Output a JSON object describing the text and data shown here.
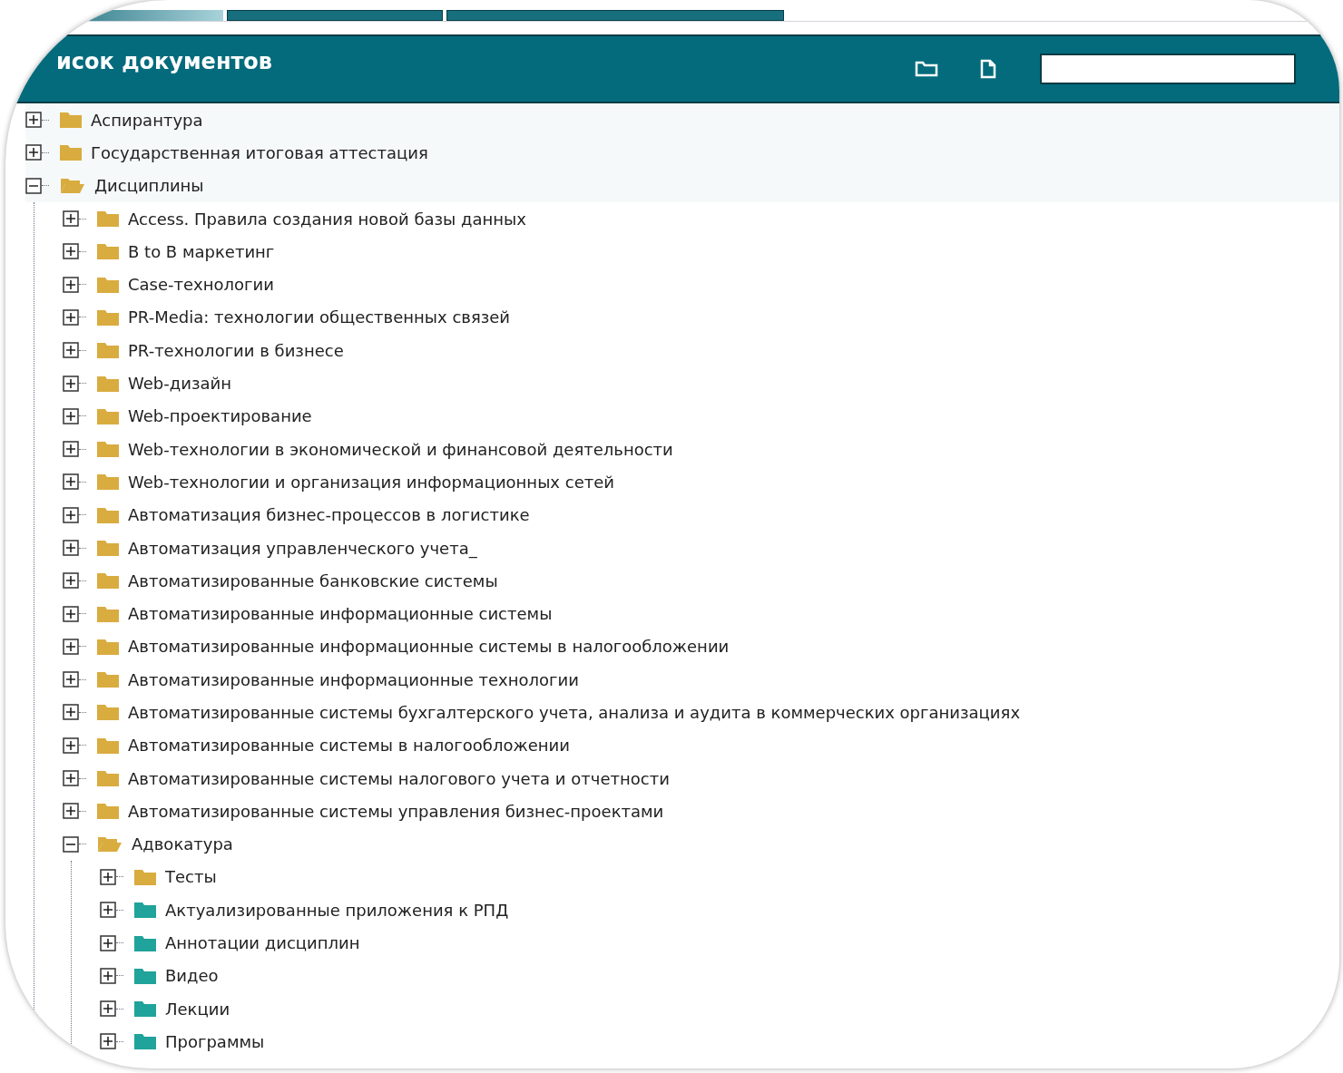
{
  "tabs": [
    {
      "selected": false
    },
    {
      "selected": true
    },
    {
      "selected": true
    }
  ],
  "header": {
    "title": "исок документов"
  },
  "tree": [
    {
      "label": "Аспирантура",
      "color": "#d9ac3f",
      "expanded": false
    },
    {
      "label": "Государственная итоговая аттестация",
      "color": "#d9ac3f",
      "expanded": false
    },
    {
      "label": "Дисциплины",
      "color": "#d9ac3f",
      "expanded": true,
      "children": [
        {
          "label": "Access. Правила создания новой базы данных",
          "color": "#d9ac3f",
          "expanded": false
        },
        {
          "label": "B to B маркетинг",
          "color": "#d9ac3f",
          "expanded": false
        },
        {
          "label": "Case-технологии",
          "color": "#d9ac3f",
          "expanded": false
        },
        {
          "label": "PR-Media: технологии общественных связей",
          "color": "#d9ac3f",
          "expanded": false
        },
        {
          "label": "PR-технологии в бизнесе",
          "color": "#d9ac3f",
          "expanded": false
        },
        {
          "label": "Web-дизайн",
          "color": "#d9ac3f",
          "expanded": false
        },
        {
          "label": "Web-проектирование",
          "color": "#d9ac3f",
          "expanded": false
        },
        {
          "label": "Web-технологии в экономической и финансовой деятельности",
          "color": "#d9ac3f",
          "expanded": false
        },
        {
          "label": "Web-технологии и организация информационных сетей",
          "color": "#d9ac3f",
          "expanded": false
        },
        {
          "label": "Автоматизация бизнес-процессов в логистике",
          "color": "#d9ac3f",
          "expanded": false
        },
        {
          "label": "Автоматизация управленческого учета_",
          "color": "#d9ac3f",
          "expanded": false
        },
        {
          "label": "Автоматизированные банковские системы",
          "color": "#d9ac3f",
          "expanded": false
        },
        {
          "label": "Автоматизированные информационные системы",
          "color": "#d9ac3f",
          "expanded": false
        },
        {
          "label": "Автоматизированные информационные системы в налогообложении",
          "color": "#d9ac3f",
          "expanded": false
        },
        {
          "label": "Автоматизированные информационные технологии",
          "color": "#d9ac3f",
          "expanded": false
        },
        {
          "label": "Автоматизированные системы бухгалтерского учета, анализа и аудита в коммерческих организациях",
          "color": "#d9ac3f",
          "expanded": false
        },
        {
          "label": "Автоматизированные системы в налогообложении",
          "color": "#d9ac3f",
          "expanded": false
        },
        {
          "label": "Автоматизированные системы налогового учета и отчетности",
          "color": "#d9ac3f",
          "expanded": false
        },
        {
          "label": "Автоматизированные системы управления бизнес-проектами",
          "color": "#d9ac3f",
          "expanded": false
        },
        {
          "label": "Адвокатура",
          "color": "#d9ac3f",
          "expanded": true,
          "children": [
            {
              "label": "Тесты",
              "color": "#d9ac3f",
              "expanded": false
            },
            {
              "label": "Актуализированные приложения к РПД",
              "color": "#1fa39a",
              "expanded": false
            },
            {
              "label": "Аннотации дисциплин",
              "color": "#1fa39a",
              "expanded": false
            },
            {
              "label": "Видео",
              "color": "#1fa39a",
              "expanded": false
            },
            {
              "label": "Лекции",
              "color": "#1fa39a",
              "expanded": false
            },
            {
              "label": "Программы",
              "color": "#1fa39a",
              "expanded": false
            }
          ]
        }
      ]
    }
  ]
}
